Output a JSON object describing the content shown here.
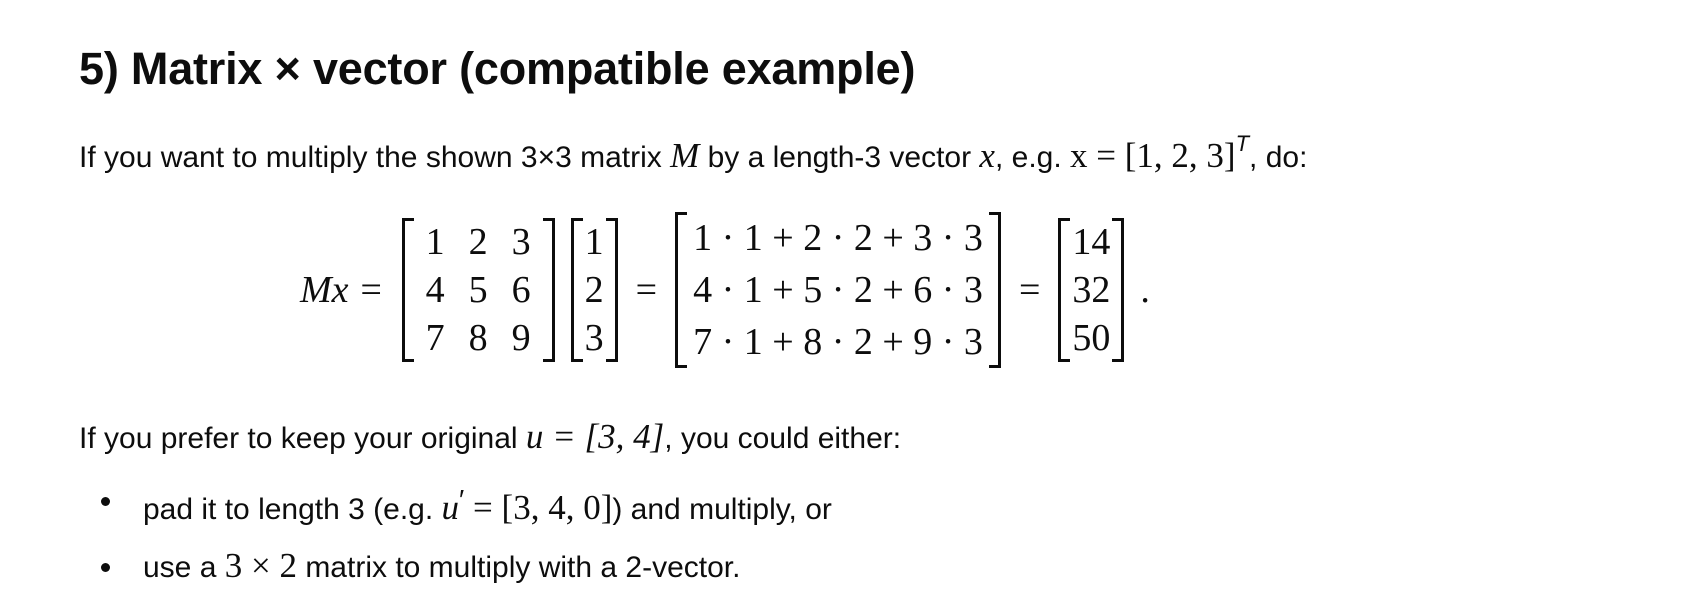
{
  "heading": "5) Matrix × vector (compatible example)",
  "intro": {
    "t1": "If you want to multiply the shown 3×3 matrix ",
    "M": "M",
    "t2": " by a length-3 vector ",
    "x": "x",
    "t3": ", e.g. ",
    "x_def": "x = [1, 2, 3]",
    "sup": "T",
    "t4": ", do:"
  },
  "equation": {
    "lhs": "Mx =",
    "matrix": [
      [
        "1",
        "2",
        "3"
      ],
      [
        "4",
        "5",
        "6"
      ],
      [
        "7",
        "8",
        "9"
      ]
    ],
    "vector": [
      "1",
      "2",
      "3"
    ],
    "eq1": "=",
    "expanded": [
      "1 · 1 + 2 · 2 + 3 · 3",
      "4 · 1 + 5 · 2 + 6 · 3",
      "7 · 1 + 8 · 2 + 9 · 3"
    ],
    "eq2": "=",
    "result": [
      "14",
      "32",
      "50"
    ],
    "end": "."
  },
  "prefer": {
    "t1": "If you prefer to keep your original ",
    "u_def": "u = [3, 4]",
    "t2": ", you could either:"
  },
  "bullets": {
    "b1_t1": "pad it to length 3 (e.g. ",
    "b1_u": "u",
    "b1_prime": "′",
    "b1_math": " = [3, 4, 0]",
    "b1_t2": ") and multiply, or",
    "b2_t1": "use a ",
    "b2_math": "3 × 2",
    "b2_t2": " matrix to multiply with a 2-vector."
  }
}
